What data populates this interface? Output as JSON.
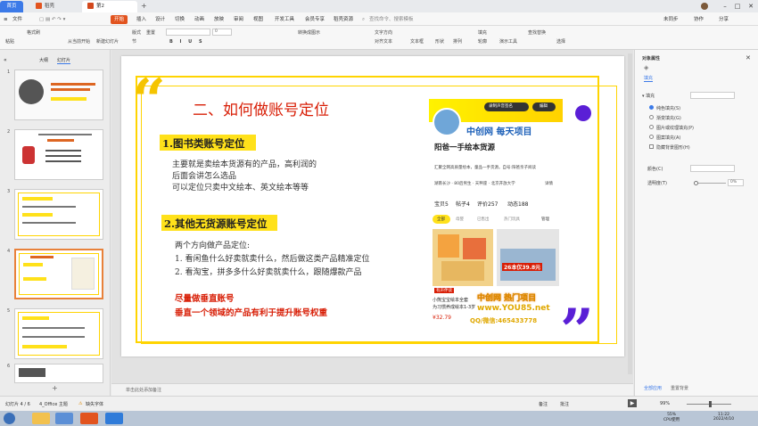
{
  "titlebar": {
    "home_tab": "首页",
    "tab1": "稻壳",
    "tab2": "第2课：.ppt"
  },
  "menus": [
    "文件",
    "开始",
    "插入",
    "设计",
    "切换",
    "动画",
    "放映",
    "审阅",
    "视图",
    "开发工具",
    "会员专享",
    "稻壳资源"
  ],
  "menu_active": "开始",
  "search_placeholder": "查找命令、搜索模板",
  "topright": {
    "sync": "未同步",
    "collab": "协作",
    "share": "分享"
  },
  "ribbon": {
    "paste": "粘贴",
    "format_painter": "格式刷",
    "current_pos": "从当前开始",
    "new_slide": "新建幻灯片",
    "layout": "版式",
    "section": "节",
    "reset": "重置",
    "font_size": "0",
    "text_box": "文本框",
    "shapes": "形状",
    "arrange": "排列",
    "picture": "图片",
    "fill": "填充",
    "outline": "轮廓",
    "find_replace": "查找替换",
    "select": "选择",
    "convert_smartart": "转换成图示",
    "text_dir": "文字方向",
    "align_text": "对齐文本",
    "text_effects": "演示工具"
  },
  "leftpanel": {
    "tab_outline": "大纲",
    "tab_slides": "幻灯片",
    "slide_numbers": [
      "1",
      "2",
      "3",
      "4",
      "5",
      "6"
    ],
    "selected": 3
  },
  "slide": {
    "title": "二、如何做账号定位",
    "section1": "1.图书类账号定位",
    "body1": [
      "主要就是卖绘本货源有的产品，高利润的",
      "后面会讲怎么选品",
      "可以定位只卖中文绘本、英文绘本等等"
    ],
    "section2": "2.其他无货源账号定位",
    "body2_intro": "两个方向做产品定位:",
    "body2": [
      "1. 看闲鱼什么好卖就卖什么，然后做这类产品精准定位",
      "2. 看淘宝，拼多多什么好卖就卖什么，跟随爆款产品"
    ],
    "red1": "尽量做垂直账号",
    "red2": "垂直一个领域的产品有利于提升账号权重",
    "phone": {
      "shop_name": "阳爸一手绘本货源",
      "banner": "中创网 每天项目",
      "edit_btn": "编辑",
      "record_btn": "录制声音签名",
      "desc": "汇聚全网高质量绘本，童品一手货源。自号:阳爸亲子阅读",
      "location": "湖南长沙 · 80后男生 · 天秤座 · 北京开放大学",
      "detail": "详情",
      "stats": [
        "宝贝5",
        "帖子4",
        "评价257",
        "动态188"
      ],
      "filters": [
        "全部",
        "母婴",
        "已售出",
        "热门玩具",
        "管理"
      ],
      "price_tag": "26本仅39.8元",
      "item_title": "小熊宝宝绘本全套",
      "item_sub": "为习惯养成绘本1-3岁",
      "price": "¥32.79",
      "price_red": "有声伴读",
      "wm1": "中创网 热门项目",
      "wm2": "www.YOU85.net",
      "wm3": "QQ/微信:465433778"
    }
  },
  "notes_placeholder": "单击此处添加备注",
  "rightpanel": {
    "title": "对象属性",
    "tab": "填充",
    "section": "填充",
    "options": [
      "纯色填充(S)",
      "渐变填充(G)",
      "图片或纹理填充(P)",
      "图案填充(A)",
      "隐藏背景图形(H)"
    ],
    "color_label": "颜色(C)",
    "transparency_label": "透明度(T)",
    "transparency_value": "0%",
    "apply_all": "全部应用",
    "reset_bg": "重置背景"
  },
  "status": {
    "slide_pos": "幻灯片 4 / 6",
    "theme": "4_Office 主题",
    "font_missing": "缺失字体",
    "notes": "备注",
    "comments": "批注",
    "zoom": "99%"
  },
  "taskbar": {
    "cpu": "55%",
    "cpu_label": "CPU使用",
    "time": "11:22",
    "date": "2022/4/10"
  },
  "colors": {
    "accent": "#e2541f",
    "yellow": "#ffe11a",
    "red": "#d81e06",
    "purple": "#5a1fd6",
    "blue": "#1b5fb8"
  }
}
